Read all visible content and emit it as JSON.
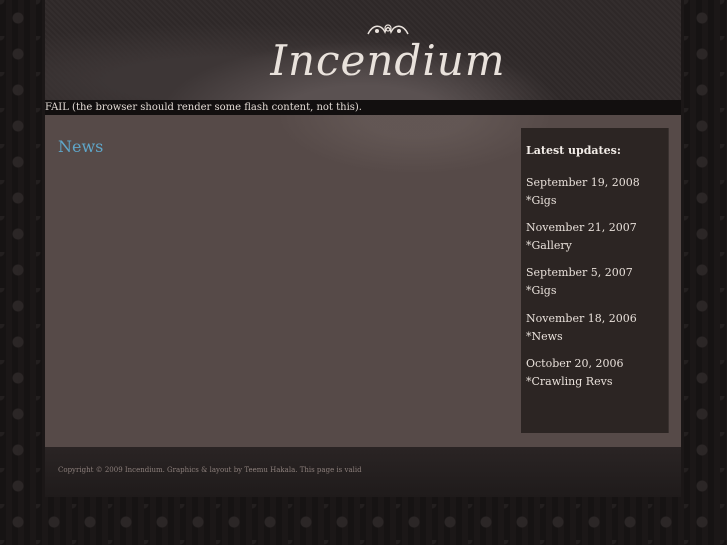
{
  "header": {
    "logo_text": "Incendium"
  },
  "flash_message": "FAIL (the browser should render some flash content, not this).",
  "main": {
    "news_title": "News"
  },
  "sidebar": {
    "title": "Latest updates:",
    "updates": [
      {
        "date": "September 19, 2008",
        "item": "*Gigs"
      },
      {
        "date": "November 21, 2007",
        "item": "*Gallery"
      },
      {
        "date": "September 5, 2007",
        "item": "*Gigs"
      },
      {
        "date": "November 18, 2006",
        "item": "*News"
      },
      {
        "date": "October 20, 2006",
        "item": "*Crawling Revs"
      }
    ]
  },
  "footer": {
    "copyright": "Copyright © 2009 Incendium. Graphics & layout by Teemu Hakala. This page is valid"
  },
  "colors": {
    "accent": "#5fa6c9",
    "content_bg": "#564a48",
    "sidebar_bg": "#2c2523"
  }
}
